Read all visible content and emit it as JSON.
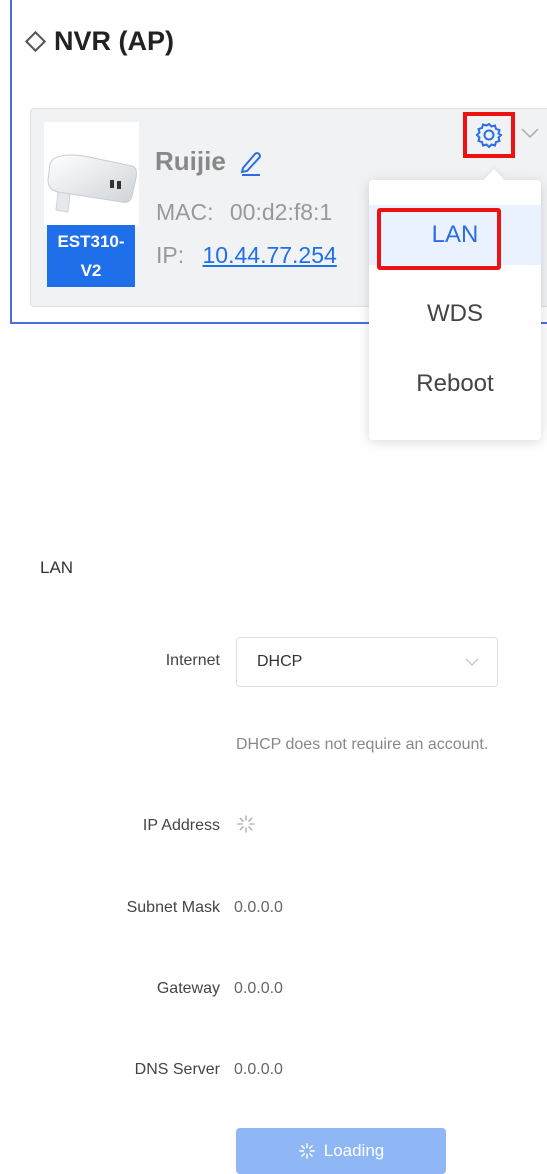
{
  "section": {
    "title": "NVR (AP)"
  },
  "device": {
    "name": "Ruijie",
    "model_line1": "EST310-",
    "model_line2": "V2",
    "mac_label": "MAC:",
    "mac_value": "00:d2:f8:1",
    "ip_label": "IP:",
    "ip_value": "10.44.77.254"
  },
  "menu": {
    "items": [
      {
        "label": "LAN"
      },
      {
        "label": "WDS"
      },
      {
        "label": "Reboot"
      }
    ]
  },
  "lan": {
    "heading": "LAN",
    "internet_label": "Internet",
    "internet_value": "DHCP",
    "hint": "DHCP does not require an account.",
    "ip_label": "IP Address",
    "subnet_label": "Subnet Mask",
    "subnet_value": "0.0.0.0",
    "gateway_label": "Gateway",
    "gateway_value": "0.0.0.0",
    "dns_label": "DNS Server",
    "dns_value": "0.0.0.0",
    "button_label": "Loading"
  },
  "colors": {
    "accent": "#1f6feb",
    "highlight_box": "#ee1111",
    "button_loading": "#8fb7f5"
  }
}
